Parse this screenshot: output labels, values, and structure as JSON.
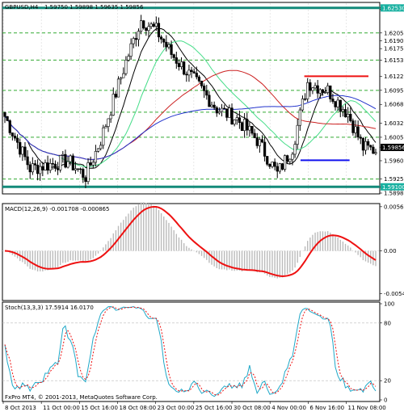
{
  "chart_data": [
    {
      "type": "candlestick",
      "title": "GBPUSD,H4",
      "ohlc_text": "1.59750 1.59898 1.59635 1.59856",
      "y_ticks": [
        1.6253,
        1.625,
        1.6205,
        1.619,
        1.6175,
        1.6153,
        1.6122,
        1.6095,
        1.6068,
        1.6032,
        1.6005,
        1.5986,
        1.596,
        1.5925,
        1.591,
        1.5898
      ],
      "highlight_labels": [
        {
          "text": "1.62530",
          "value": 1.6253,
          "color": "#18b0a0"
        },
        {
          "text": "1.59856",
          "value": 1.59856,
          "color": "#000000"
        },
        {
          "text": "1.59100",
          "value": 1.591,
          "color": "#18b0a0"
        }
      ],
      "horizontal_lines": [
        {
          "value": 1.6253,
          "color": "#138a7a",
          "width": 3
        },
        {
          "value": 1.591,
          "color": "#138a7a",
          "width": 3
        },
        {
          "value": 1.6095,
          "color": "#33aa33",
          "style": "dashed"
        },
        {
          "value": 1.6053,
          "color": "#33aa33",
          "style": "dashed"
        },
        {
          "value": 1.6005,
          "color": "#33aa33",
          "style": "dashed"
        },
        {
          "value": 1.5925,
          "color": "#33aa33",
          "style": "dashed"
        },
        {
          "value": 1.6153,
          "color": "#33aa33",
          "style": "dashed"
        },
        {
          "value": 1.6205,
          "color": "#33aa33",
          "style": "dashed"
        }
      ],
      "segments": [
        {
          "x_from": 0.8,
          "x_to": 0.97,
          "value": 1.6122,
          "color": "#ee1111"
        },
        {
          "x_from": 0.79,
          "x_to": 0.92,
          "value": 1.5961,
          "color": "#1111ee"
        }
      ],
      "moving_averages": [
        {
          "color": "#000000"
        },
        {
          "color": "#44dd88"
        },
        {
          "color": "#cc2222"
        },
        {
          "color": "#2233cc"
        }
      ],
      "ylim": [
        1.5898,
        1.6262
      ]
    },
    {
      "type": "macd",
      "label": "MACD(12,26,9) -0.001708 -0.000865",
      "y_ticks": [
        0.005608,
        0.0,
        -0.005432
      ],
      "y_tick_labels": [
        "0.005608",
        "0.00",
        "-0.005432"
      ],
      "signal_color": "#ee1111",
      "histogram_color": "#bbbbbb",
      "ylim": [
        -0.0062,
        0.0059
      ]
    },
    {
      "type": "stochastic",
      "label": "Stoch(13,3,3) 17.5914 16.0170",
      "y_ticks": [
        100,
        80,
        20,
        0
      ],
      "main_color": "#1fa8c8",
      "signal_color": "#ee1111",
      "ylim": [
        0,
        100
      ]
    }
  ],
  "x_ticks": [
    "8 Oct 2013",
    "11 Oct 00:00",
    "15 Oct 16:00",
    "18 Oct 08:00",
    "23 Oct 00:00",
    "25 Oct 16:00",
    "30 Oct 08:00",
    "4 Nov 00:00",
    "6 Nov 16:00",
    "11 Nov 08:00"
  ],
  "copyright": "FxPro MT4, © 2001-2013, MetaQuotes Software Corp."
}
